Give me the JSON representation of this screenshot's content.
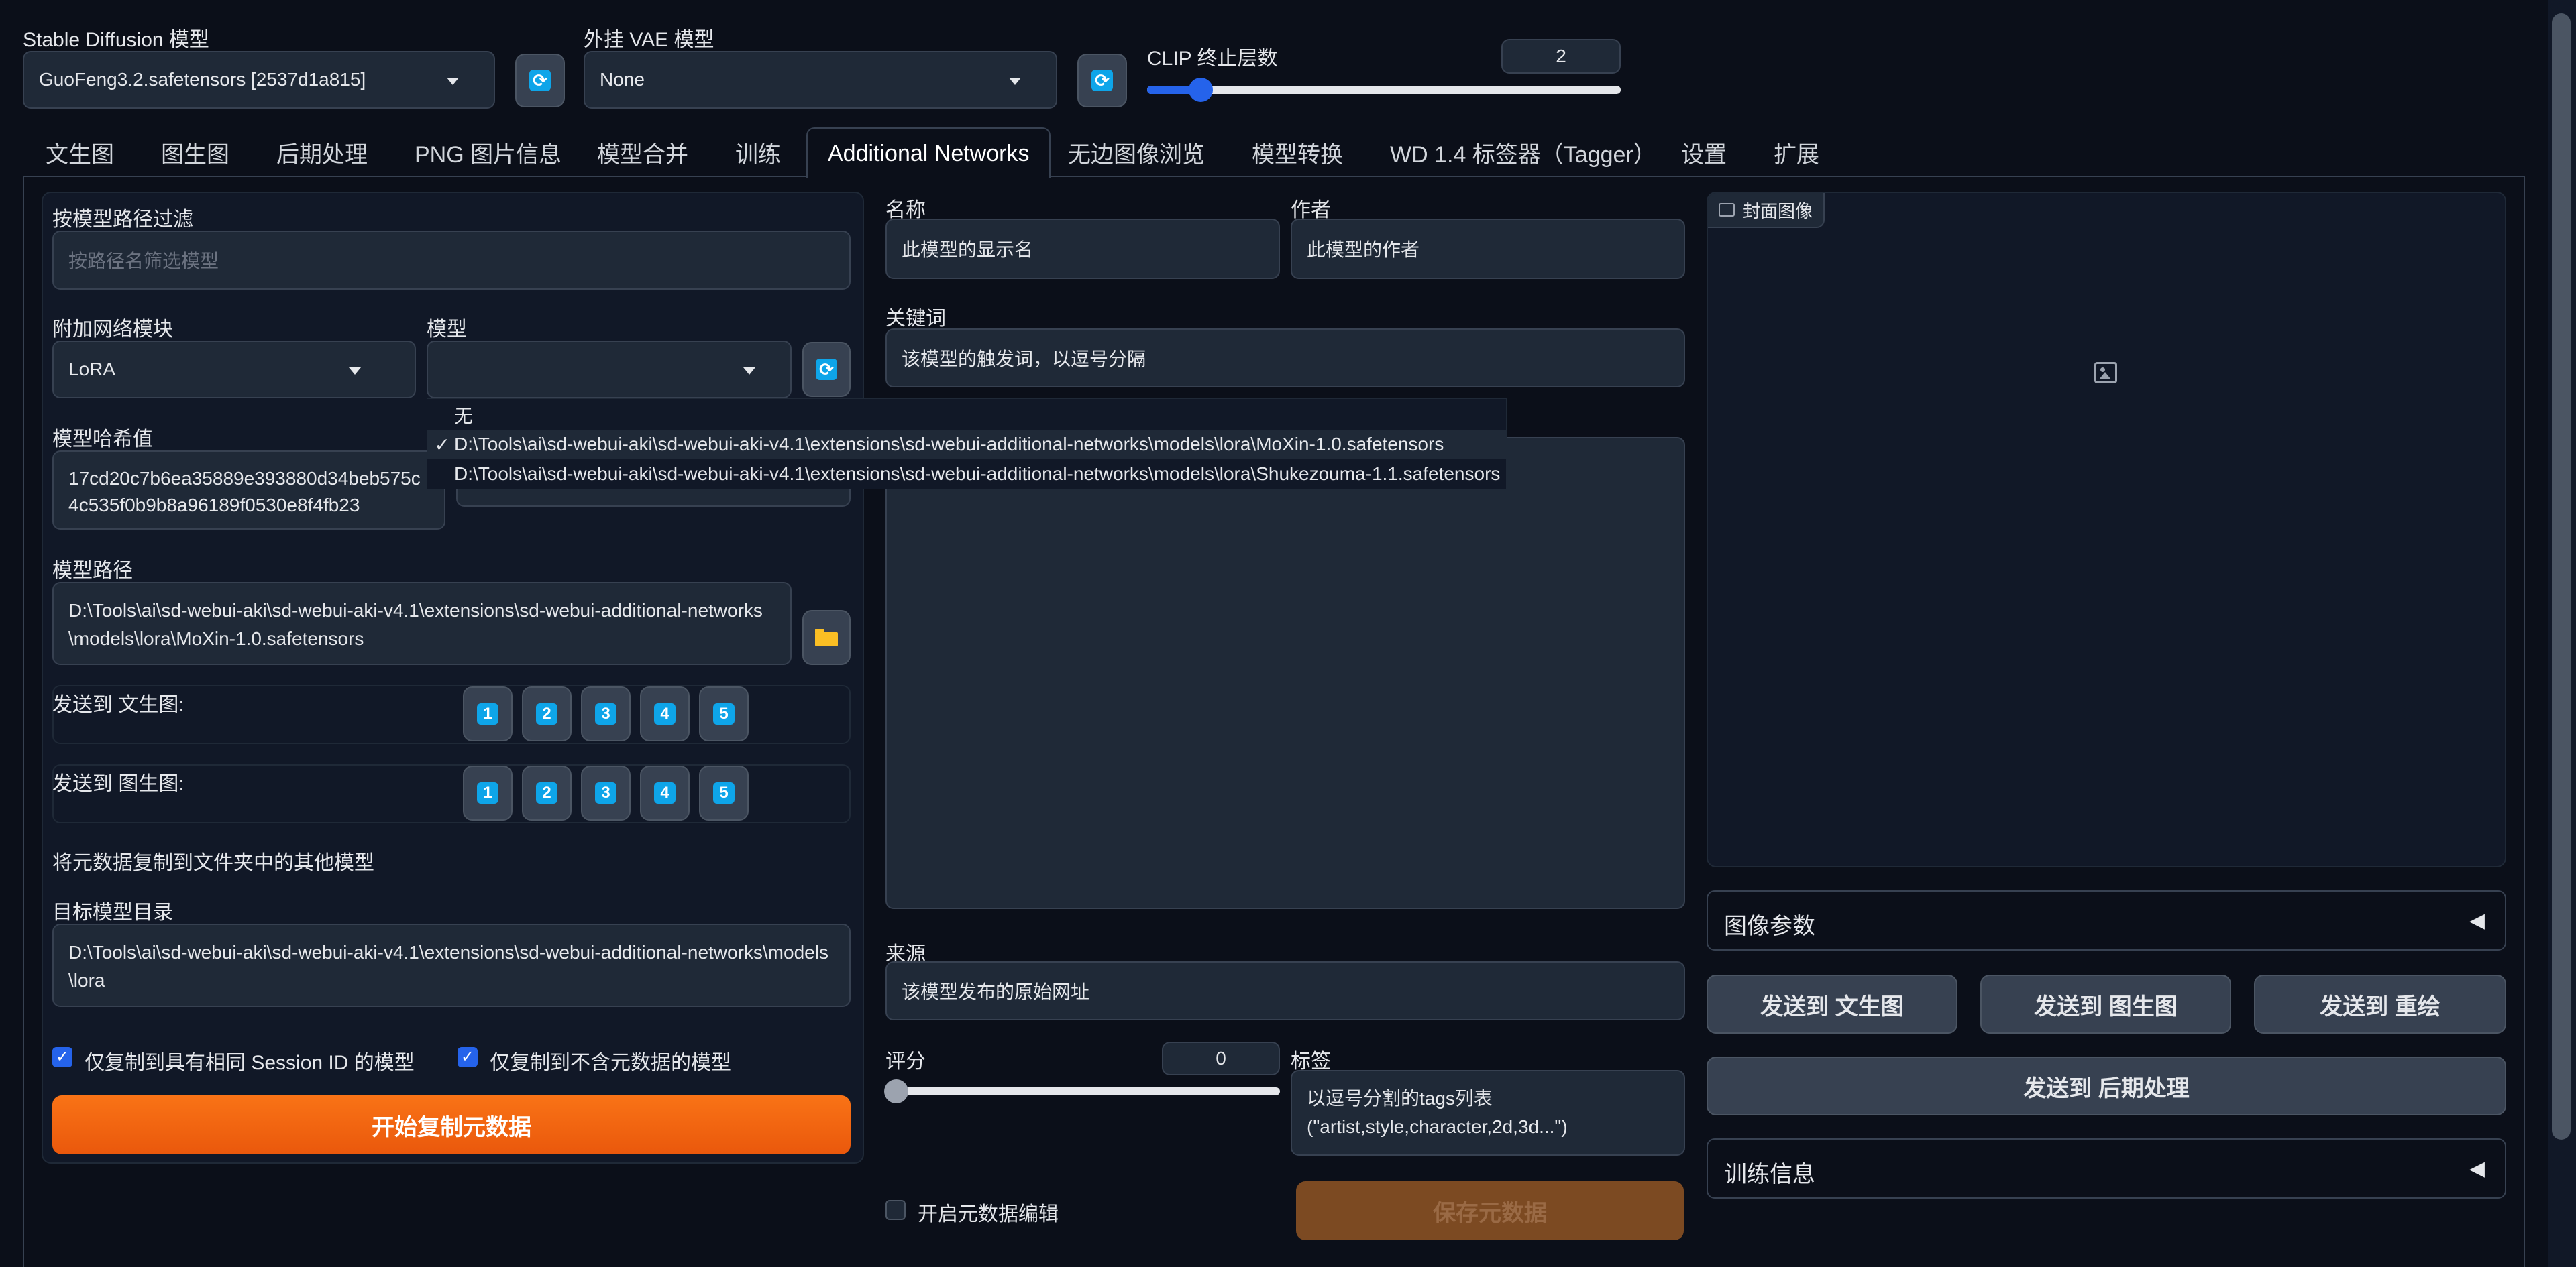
{
  "top": {
    "sd_model_label": "Stable Diffusion 模型",
    "sd_model_value": "GuoFeng3.2.safetensors [2537d1a815]",
    "vae_label": "外挂 VAE 模型",
    "vae_value": "None",
    "clip_label": "CLIP 终止层数",
    "clip_value": "2"
  },
  "tabs": [
    {
      "label": "文生图"
    },
    {
      "label": "图生图"
    },
    {
      "label": "后期处理"
    },
    {
      "label": "PNG 图片信息"
    },
    {
      "label": "模型合并"
    },
    {
      "label": "训练"
    },
    {
      "label": "Additional Networks"
    },
    {
      "label": "无边图像浏览"
    },
    {
      "label": "模型转换"
    },
    {
      "label": "WD 1.4 标签器（Tagger）"
    },
    {
      "label": "设置"
    },
    {
      "label": "扩展"
    }
  ],
  "left": {
    "filter_label": "按模型路径过滤",
    "filter_placeholder": "按路径名筛选模型",
    "module_label": "附加网络模块",
    "module_value": "LoRA",
    "model_label": "模型",
    "model_value": "",
    "hash_label": "模型哈希值",
    "hash_value": "17cd20c7b6ea35889e393880d34beb575c4c535f0b9b8a96189f0530e8f4fb23",
    "path_label": "模型路径",
    "path_value": "D:\\Tools\\ai\\sd-webui-aki\\sd-webui-aki-v4.1\\extensions\\sd-webui-additional-networks\\models\\lora\\MoXin-1.0.safetensors",
    "send_txt2img_label": "发送到 文生图:",
    "send_img2img_label": "发送到 图生图:",
    "slots": [
      "1",
      "2",
      "3",
      "4",
      "5"
    ],
    "copy_heading": "将元数据复制到文件夹中的其他模型",
    "target_dir_label": "目标模型目录",
    "target_dir_value": "D:\\Tools\\ai\\sd-webui-aki\\sd-webui-aki-v4.1\\extensions\\sd-webui-additional-networks\\models\\lora",
    "check1_label": "仅复制到具有相同 Session ID 的模型",
    "check2_label": "仅复制到不含元数据的模型",
    "start_copy_label": "开始复制元数据"
  },
  "dropdown": {
    "items": [
      {
        "check": "",
        "label": "无"
      },
      {
        "check": "✓",
        "label": "D:\\Tools\\ai\\sd-webui-aki\\sd-webui-aki-v4.1\\extensions\\sd-webui-additional-networks\\models\\lora\\MoXin-1.0.safetensors"
      },
      {
        "check": "",
        "label": "D:\\Tools\\ai\\sd-webui-aki\\sd-webui-aki-v4.1\\extensions\\sd-webui-additional-networks\\models\\lora\\Shukezouma-1.1.safetensors"
      }
    ]
  },
  "middle": {
    "name_label": "名称",
    "name_value": "此模型的显示名",
    "author_label": "作者",
    "author_value": "此模型的作者",
    "keywords_label": "关键词",
    "keywords_value": "该模型的触发词，以逗号分隔",
    "source_label": "来源",
    "source_value": "该模型发布的原始网址",
    "rating_label": "评分",
    "rating_value": "0",
    "tags_label": "标签",
    "tags_line1": "以逗号分割的tags列表",
    "tags_line2": "(\"artist,style,character,2d,3d...\")",
    "enable_edit_label": "开启元数据编辑",
    "save_label": "保存元数据"
  },
  "right": {
    "cover_label": "封面图像",
    "image_params_label": "图像参数",
    "send_txt2img": "发送到 文生图",
    "send_img2img": "发送到 图生图",
    "send_inpaint": "发送到 重绘",
    "send_extras": "发送到 后期处理",
    "train_info_label": "训练信息",
    "collapse_glyph": "◀"
  },
  "colors": {
    "accent_orange": "#f97316",
    "accent_blue": "#0ea5e9",
    "background": "#0b0f19",
    "panel": "#111827"
  }
}
